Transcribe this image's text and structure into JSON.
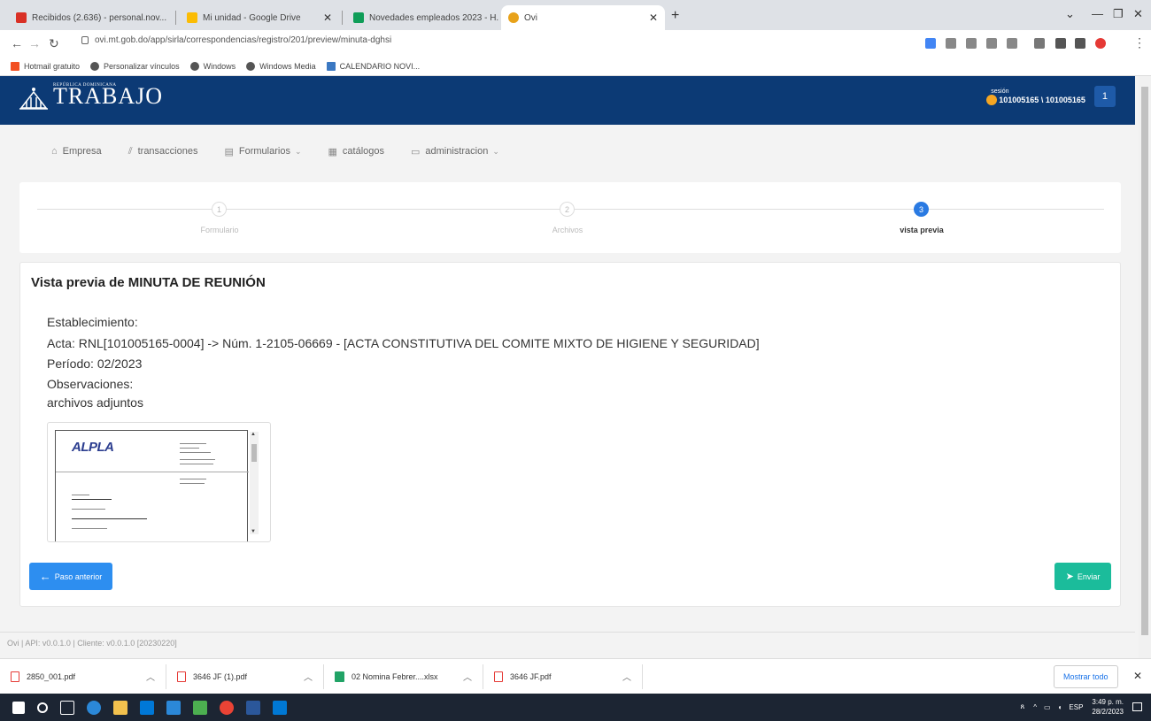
{
  "browser": {
    "tabs": [
      {
        "title": "Recibidos (2.636) - personal.nov...",
        "color": "#d93025"
      },
      {
        "title": "Mi unidad - Google Drive",
        "color": "#fbbc04"
      },
      {
        "title": "Novedades empleados 2023 - H...",
        "color": "#0f9d58"
      },
      {
        "title": "Ovi",
        "color": "#e8a21a"
      }
    ],
    "url": "ovi.mt.gob.do/app/sirla/correspondencias/registro/201/preview/minuta-dghsi",
    "bookmarks": [
      "Hotmail gratuito",
      "Personalizar vínculos",
      "Windows",
      "Windows Media",
      "CALENDARIO NOVI..."
    ]
  },
  "header": {
    "logo_small": "REPÚBLICA DOMINICANA",
    "logo_big": "TRABAJO",
    "session_label": "sesión",
    "user_name": "101005165 \\ 101005165",
    "badge": "1"
  },
  "menu": [
    {
      "label": "Empresa",
      "icon": "building-icon",
      "glyph": "⌂",
      "dropdown": false
    },
    {
      "label": "transacciones",
      "icon": "chart-icon",
      "glyph": "⫽",
      "dropdown": false
    },
    {
      "label": "Formularios",
      "icon": "file-icon",
      "glyph": "▤",
      "dropdown": true
    },
    {
      "label": "catálogos",
      "icon": "catalog-icon",
      "glyph": "▦",
      "dropdown": false
    },
    {
      "label": "administracion",
      "icon": "admin-icon",
      "glyph": "▭",
      "dropdown": true
    }
  ],
  "stepper": {
    "steps": [
      {
        "num": "1",
        "label": "Formulario"
      },
      {
        "num": "2",
        "label": "Archivos"
      },
      {
        "num": "3",
        "label": "vista previa"
      }
    ],
    "active": 3
  },
  "preview": {
    "title": "Vista previa de MINUTA DE REUNIÓN",
    "establecimiento": "Establecimiento:",
    "acta": "Acta: RNL[101005165-0004] -> Núm. 1-2105-06669 - [ACTA CONSTITUTIVA DEL COMITE MIXTO DE HIGIENE Y SEGURIDAD]",
    "periodo": "Período: 02/2023",
    "observaciones": "Observaciones:",
    "adjuntos": "archivos adjuntos",
    "thumb_brand": "ALPLA",
    "btn_prev": "Paso anterior",
    "btn_send": "Enviar"
  },
  "footer": "Ovi | API: v0.0.1.0 | Cliente: v0.0.1.0 [20230220]",
  "downloads": [
    {
      "name": "2850_001.pdf",
      "type": "pdf"
    },
    {
      "name": "3646 JF (1).pdf",
      "type": "pdf"
    },
    {
      "name": "02 Nomina Febrer....xlsx",
      "type": "xls"
    },
    {
      "name": "3646 JF.pdf",
      "type": "pdf"
    }
  ],
  "show_all": "Mostrar todo",
  "taskbar": {
    "lang": "ESP",
    "time": "3:49 p. m.",
    "date": "28/2/2023"
  }
}
